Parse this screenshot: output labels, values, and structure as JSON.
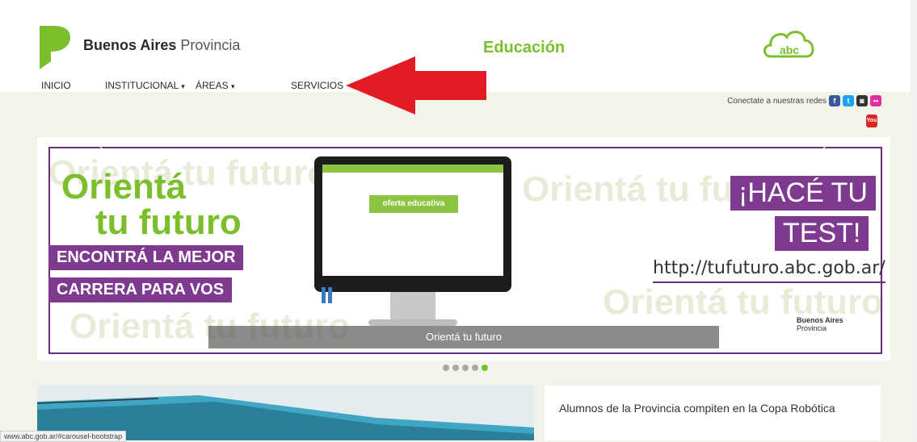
{
  "header": {
    "brand_bold": "Buenos Aires",
    "brand_thin": "Provincia",
    "section_title": "Educación",
    "abc_logo_text": "abc"
  },
  "nav": {
    "items": [
      {
        "label": "INICIO"
      },
      {
        "label": "INSTITUCIONAL"
      },
      {
        "label": "ÁREAS"
      },
      {
        "label": "SERVICIOS"
      }
    ]
  },
  "social": {
    "label": "Conectate a nuestras redes",
    "icons": [
      "facebook-icon",
      "twitter-icon",
      "instagram-icon",
      "flickr-icon",
      "youtube-icon"
    ],
    "youtube_text": "You"
  },
  "banner": {
    "bg_text": "Orientá tu futuro",
    "orienta": "Orientá",
    "tu_futuro": "tu futuro",
    "tag1": "ENCONTRÁ LA MEJOR",
    "tag2": "CARRERA PARA VOS",
    "hace_line1": "¡HACÉ TU",
    "hace_line2": "TEST!",
    "url": "http://tufuturo.abc.gob.ar/",
    "screen_button": "oferta educativa",
    "caption": "Orientá tu futuro",
    "corner_brand_1": "Buenos Aires",
    "corner_brand_2": "Provincia",
    "prev": "‹",
    "next": "›"
  },
  "carousel": {
    "dots": 5,
    "active_index": 4
  },
  "news": {
    "title": "Alumnos de la Provincia compiten en la Copa Robótica"
  },
  "status_bar": {
    "url": "www.abc.gob.ar/#carousel-bootstrap"
  },
  "colors": {
    "green": "#7cbf2d",
    "purple": "#7d3a8f",
    "arrow_red": "#e31b23"
  }
}
